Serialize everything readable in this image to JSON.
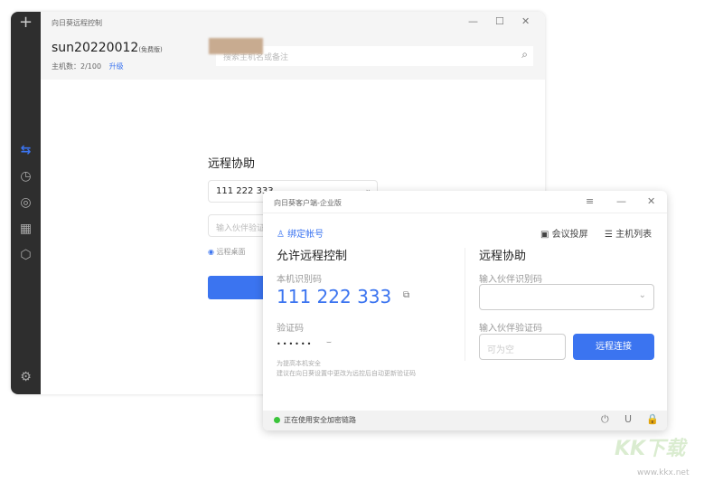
{
  "main": {
    "title": "向日葵远程控制",
    "username": "sun20220012",
    "edition": "(免费版)",
    "host_count_label": "主机数：2/100",
    "upgrade": "升级",
    "search_placeholder": "搜索主机名或备注",
    "section_title": "远程协助",
    "partner_id_value": "111 222 333",
    "partner_code_placeholder": "输入伙伴验证码",
    "mode_option": "远程桌面"
  },
  "sidebar": {
    "icons": [
      "add-icon",
      "remote-assist-icon",
      "history-icon",
      "webcam-icon",
      "apps-icon",
      "box-icon",
      "settings-icon"
    ]
  },
  "client": {
    "title": "向日葵客户端-企业版",
    "bind_account": "绑定帐号",
    "meeting_cast": "会议投屏",
    "host_list": "主机列表",
    "allow_title": "允许远程控制",
    "local_id_label": "本机识别码",
    "local_id": "111 222 333",
    "verify_label": "验证码",
    "verify_mask": "••••••",
    "tip1": "为提高本机安全",
    "tip2": "建议在向日葵设置中更改为远控后自动更新验证码",
    "assist_title": "远程协助",
    "partner_id_label": "输入伙伴识别码",
    "partner_code_label": "输入伙伴验证码",
    "partner_code_placeholder": "可为空",
    "connect": "远程连接",
    "status": "正在使用安全加密链路"
  },
  "watermark": {
    "text": "KK下载",
    "url": "www.kkx.net"
  },
  "colors": {
    "accent": "#3b74f0",
    "status": "#3ac43a"
  }
}
